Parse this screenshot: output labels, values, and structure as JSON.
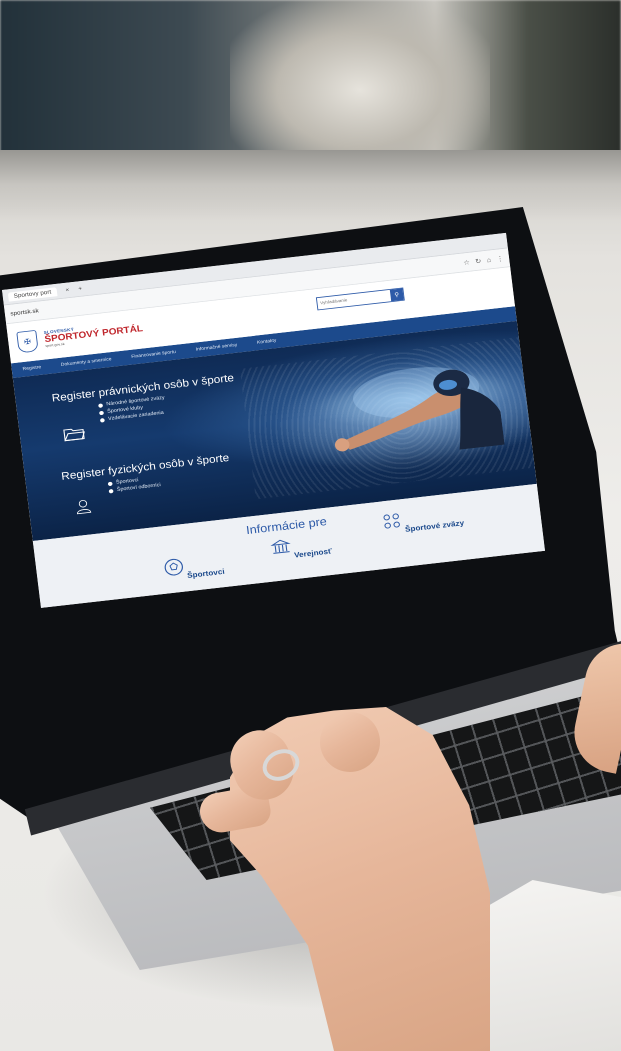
{
  "browser": {
    "tab_label": "Sportovy port",
    "url": "sportsk.sk",
    "toolbar_icons": [
      "star-icon",
      "refresh-icon",
      "home-icon",
      "settings-icon"
    ]
  },
  "site": {
    "logo": {
      "small": "SLOVENSKÝ",
      "big": "ŠPORTOVÝ PORTÁL",
      "sub": "sport.gov.sk"
    },
    "search": {
      "placeholder": "Vyhľadávanie"
    },
    "nav": [
      "Registre",
      "Dokumenty a smernice",
      "Financovanie športu",
      "Informačné servisy",
      "Kontakty"
    ],
    "hero": {
      "register_legal": {
        "title": "Register právnických osôb v športe",
        "items": [
          "Národné športové zväzy",
          "Športové kluby",
          "Vzdelávacie zariadenia"
        ]
      },
      "register_natural": {
        "title": "Register fyzických osôb v športe",
        "items": [
          "Športovci",
          "Športoví odborníci"
        ]
      }
    },
    "info": {
      "title": "Informácie pre",
      "items": [
        "Športovci",
        "Verejnosť",
        "Športové zväzy"
      ]
    }
  },
  "colors": {
    "brand_blue": "#2d5aa8",
    "brand_red": "#c0272d",
    "nav_blue": "#1c4a8c",
    "hero_dark": "#0f2b55"
  }
}
